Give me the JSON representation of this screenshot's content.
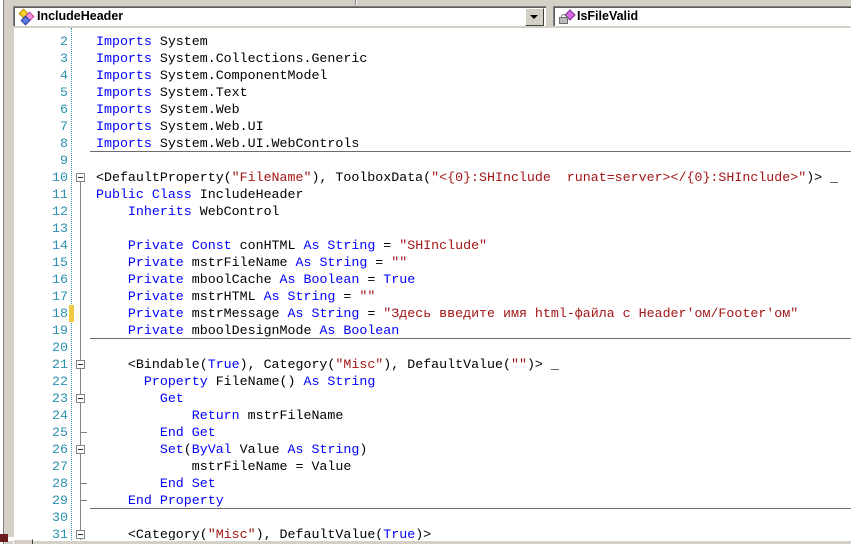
{
  "navbar": {
    "type_selector": {
      "label": "IncludeHeader",
      "icon": "class-icon"
    },
    "member_selector": {
      "label": "IsFileValid",
      "icon": "private-method-icon"
    }
  },
  "colors": {
    "keyword": "#0000FF",
    "string": "#A31515",
    "identifier": "#000000",
    "line_number": "#2B91AF",
    "change_bar": "#EFC93F",
    "chrome": "#D4D0C8",
    "fold_outline": "#848484"
  },
  "editor": {
    "first_visible_line": 2,
    "gutter": {
      "change_indicator_lines": [
        18
      ]
    },
    "separators_after": [
      8,
      19,
      29
    ],
    "fold": {
      "box_lines": [
        10,
        21,
        23,
        26,
        31
      ],
      "tick_lines": [
        25,
        28,
        29
      ]
    },
    "lines": [
      {
        "num": 2,
        "segments": [
          [
            "k",
            "Imports "
          ],
          [
            "p",
            "System"
          ]
        ]
      },
      {
        "num": 3,
        "segments": [
          [
            "k",
            "Imports "
          ],
          [
            "p",
            "System.Collections.Generic"
          ]
        ]
      },
      {
        "num": 4,
        "segments": [
          [
            "k",
            "Imports "
          ],
          [
            "p",
            "System.ComponentModel"
          ]
        ]
      },
      {
        "num": 5,
        "segments": [
          [
            "k",
            "Imports "
          ],
          [
            "p",
            "System.Text"
          ]
        ]
      },
      {
        "num": 6,
        "segments": [
          [
            "k",
            "Imports "
          ],
          [
            "p",
            "System.Web"
          ]
        ]
      },
      {
        "num": 7,
        "segments": [
          [
            "k",
            "Imports "
          ],
          [
            "p",
            "System.Web.UI"
          ]
        ]
      },
      {
        "num": 8,
        "segments": [
          [
            "k",
            "Imports "
          ],
          [
            "p",
            "System.Web.UI.WebControls"
          ]
        ]
      },
      {
        "num": 9,
        "segments": []
      },
      {
        "num": 10,
        "segments": [
          [
            "p",
            "<DefaultProperty("
          ],
          [
            "s",
            "\"FileName\""
          ],
          [
            "p",
            "), ToolboxData("
          ],
          [
            "s",
            "\"<{0}:SHInclude  runat=server></{0}:SHInclude>\""
          ],
          [
            "p",
            ")> _"
          ]
        ]
      },
      {
        "num": 11,
        "segments": [
          [
            "k",
            "Public Class "
          ],
          [
            "p",
            "IncludeHeader"
          ]
        ]
      },
      {
        "num": 12,
        "segments": [
          [
            "k",
            "    Inherits "
          ],
          [
            "p",
            "WebControl"
          ]
        ]
      },
      {
        "num": 13,
        "segments": []
      },
      {
        "num": 14,
        "segments": [
          [
            "k",
            "    Private Const "
          ],
          [
            "p",
            "conHTML "
          ],
          [
            "k",
            "As String "
          ],
          [
            "p",
            "= "
          ],
          [
            "s",
            "\"SHInclude\""
          ]
        ]
      },
      {
        "num": 15,
        "segments": [
          [
            "k",
            "    Private "
          ],
          [
            "p",
            "mstrFileName "
          ],
          [
            "k",
            "As String "
          ],
          [
            "p",
            "= "
          ],
          [
            "s",
            "\"\""
          ]
        ]
      },
      {
        "num": 16,
        "segments": [
          [
            "k",
            "    Private "
          ],
          [
            "p",
            "mboolCache "
          ],
          [
            "k",
            "As Boolean "
          ],
          [
            "p",
            "= "
          ],
          [
            "k",
            "True"
          ]
        ]
      },
      {
        "num": 17,
        "segments": [
          [
            "k",
            "    Private "
          ],
          [
            "p",
            "mstrHTML "
          ],
          [
            "k",
            "As String "
          ],
          [
            "p",
            "= "
          ],
          [
            "s",
            "\"\""
          ]
        ]
      },
      {
        "num": 18,
        "segments": [
          [
            "k",
            "    Private "
          ],
          [
            "p",
            "mstrMessage "
          ],
          [
            "k",
            "As String "
          ],
          [
            "p",
            "= "
          ],
          [
            "s",
            "\"Здесь введите имя html-файла с Header'ом/Footer'ом\""
          ]
        ]
      },
      {
        "num": 19,
        "segments": [
          [
            "k",
            "    Private "
          ],
          [
            "p",
            "mboolDesignMode "
          ],
          [
            "k",
            "As Boolean"
          ]
        ]
      },
      {
        "num": 20,
        "segments": []
      },
      {
        "num": 21,
        "segments": [
          [
            "p",
            "    <Bindable("
          ],
          [
            "k",
            "True"
          ],
          [
            "p",
            "), Category("
          ],
          [
            "s",
            "\"Misc\""
          ],
          [
            "p",
            "), DefaultValue("
          ],
          [
            "s",
            "\"\""
          ],
          [
            "p",
            ")> _"
          ]
        ]
      },
      {
        "num": 22,
        "segments": [
          [
            "k",
            "      Property "
          ],
          [
            "p",
            "FileName() "
          ],
          [
            "k",
            "As String"
          ]
        ]
      },
      {
        "num": 23,
        "segments": [
          [
            "k",
            "        Get"
          ]
        ]
      },
      {
        "num": 24,
        "segments": [
          [
            "k",
            "            Return "
          ],
          [
            "p",
            "mstrFileName"
          ]
        ]
      },
      {
        "num": 25,
        "segments": [
          [
            "k",
            "        End Get"
          ]
        ]
      },
      {
        "num": 26,
        "segments": [
          [
            "k",
            "        Set"
          ],
          [
            "p",
            "("
          ],
          [
            "k",
            "ByVal "
          ],
          [
            "p",
            "Value "
          ],
          [
            "k",
            "As String"
          ],
          [
            "p",
            ")"
          ]
        ]
      },
      {
        "num": 27,
        "segments": [
          [
            "p",
            "            mstrFileName = Value"
          ]
        ]
      },
      {
        "num": 28,
        "segments": [
          [
            "k",
            "        End Set"
          ]
        ]
      },
      {
        "num": 29,
        "segments": [
          [
            "k",
            "    End Property"
          ]
        ]
      },
      {
        "num": 30,
        "segments": []
      },
      {
        "num": 31,
        "segments": [
          [
            "p",
            "    <Category("
          ],
          [
            "s",
            "\"Misc\""
          ],
          [
            "p",
            "), DefaultValue("
          ],
          [
            "k",
            "True"
          ],
          [
            "p",
            ")>"
          ]
        ]
      }
    ]
  }
}
